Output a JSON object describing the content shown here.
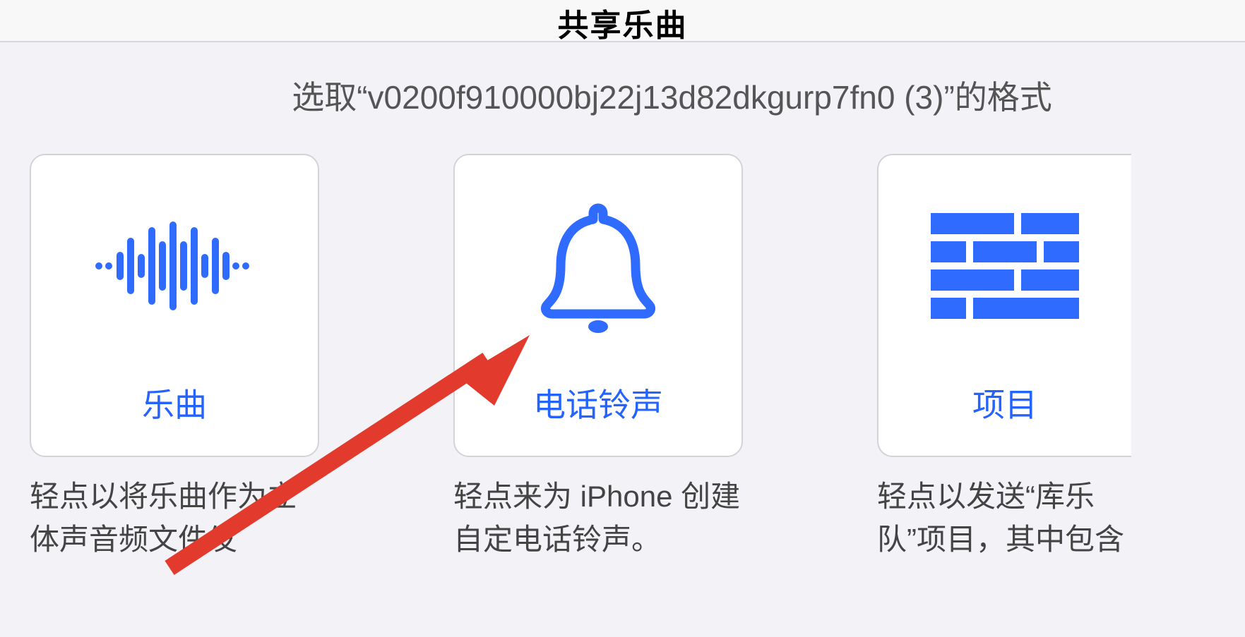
{
  "header": {
    "title": "共享乐曲"
  },
  "subtitle": "选取“v0200f910000bj22j13d82dkgurp7fn0 (3)”的格式",
  "cards": {
    "song": {
      "label": "乐曲",
      "desc": "轻点以将乐曲作为立体声音频文件发"
    },
    "ringtone": {
      "label": "电话铃声",
      "desc": "轻点来为 iPhone 创建自定电话铃声。"
    },
    "project": {
      "label": "项目",
      "desc": "轻点以发送“库乐队”项目，其中包含"
    }
  }
}
